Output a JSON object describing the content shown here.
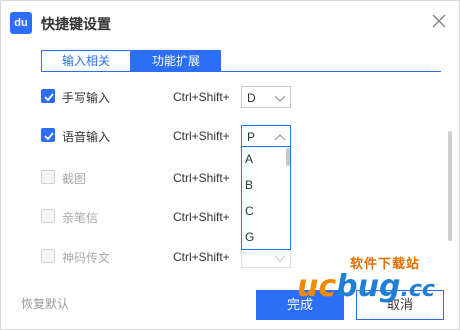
{
  "window": {
    "title": "快捷键设置",
    "logo_text": "du",
    "accent": "#2c6ff6"
  },
  "tabs": [
    {
      "label": "输入相关",
      "active": false
    },
    {
      "label": "功能扩展",
      "active": true
    }
  ],
  "rows": [
    {
      "label": "手写输入",
      "checked": true,
      "enabled": true,
      "shortcut": "Ctrl+Shift+",
      "key": "D"
    },
    {
      "label": "语音输入",
      "checked": true,
      "enabled": true,
      "shortcut": "Ctrl+Shift+",
      "key": "P"
    },
    {
      "label": "截图",
      "checked": false,
      "enabled": false,
      "shortcut": "Ctrl+Shift+",
      "key": ""
    },
    {
      "label": "亲笔信",
      "checked": false,
      "enabled": false,
      "shortcut": "Ctrl+Shift+",
      "key": ""
    },
    {
      "label": "神码传文",
      "checked": false,
      "enabled": false,
      "shortcut": "Ctrl+Shift+",
      "key": ""
    }
  ],
  "dropdown": {
    "options": [
      "A",
      "B",
      "C",
      "G"
    ]
  },
  "footer": {
    "restore_label": "恢复默认",
    "ok_label": "完成",
    "cancel_label": "取消"
  },
  "watermark": {
    "text": "软件下载站",
    "logo": {
      "u": "u",
      "c": "c",
      "bug": "bug",
      "cc": ".cc"
    }
  },
  "icons": [
    "close-icon",
    "check-icon",
    "chevron-down-icon",
    "chevron-up-icon"
  ]
}
